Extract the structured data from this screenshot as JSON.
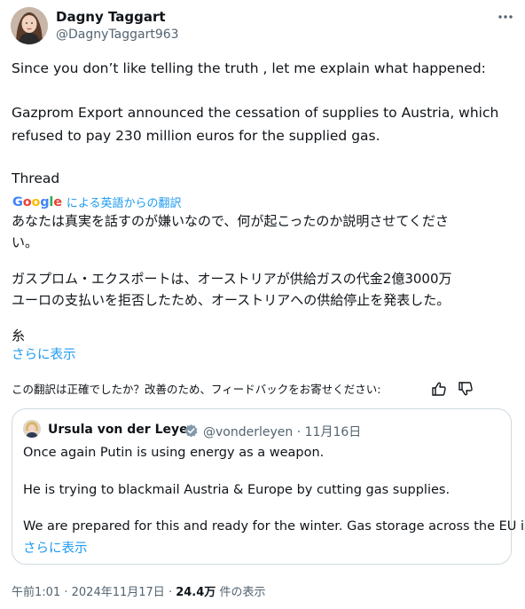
{
  "author": {
    "name": "Dagny Taggart",
    "handle": "@DagnyTaggart963"
  },
  "tweet": {
    "lines": [
      "Since you don’t like telling the truth , let me explain what happened:",
      "Gazprom Export announced the cessation of supplies to Austria, which",
      "refused to pay 230 million euros for the supplied gas.",
      "Thread"
    ]
  },
  "translation": {
    "google": "Google",
    "label": "による英語からの翻訳",
    "line1": "あなたは真実を話すのが嫌いなので、何が起こったのか説明させてくださ",
    "line2": "い。",
    "line3": "ガスプロム・エクスポートは、オーストリアが供給ガスの代金2億3000万",
    "line4": "ユーロの支払いを拒否したため、オーストリアへの供給停止を発表した。",
    "line5": "糸",
    "show_more": "さらに表示",
    "feedback": "この翻訳は正確でしたか？改善のため、フィードバックをお寄せください:"
  },
  "quote": {
    "name": "Ursula von der Leyen",
    "handle": "@vonderleyen",
    "separator": "·",
    "date": "11月16日",
    "lines": [
      "Once again Putin is using energy as a weapon.",
      "He is trying to blackmail Austria & Europe by cutting gas supplies.",
      "We are prepared for this and ready for the winter. Gas storage across the EU is ..."
    ],
    "show_more": "さらに表示"
  },
  "footer": {
    "time": "午前1:01",
    "dot": "·",
    "date": "2024年11月17日",
    "views": "24.4万",
    "views_label": "件の表示"
  },
  "colors": {
    "link": "#1d9bf0",
    "text": "#0f1419",
    "muted": "#536471",
    "border": "#cfd9de",
    "verified_gold": "#829aab"
  },
  "icons": {
    "more": "more-horizontal-icon",
    "thumb_up": "thumbs-up-icon",
    "thumb_down": "thumbs-down-icon",
    "verified": "verified-badge-icon"
  }
}
